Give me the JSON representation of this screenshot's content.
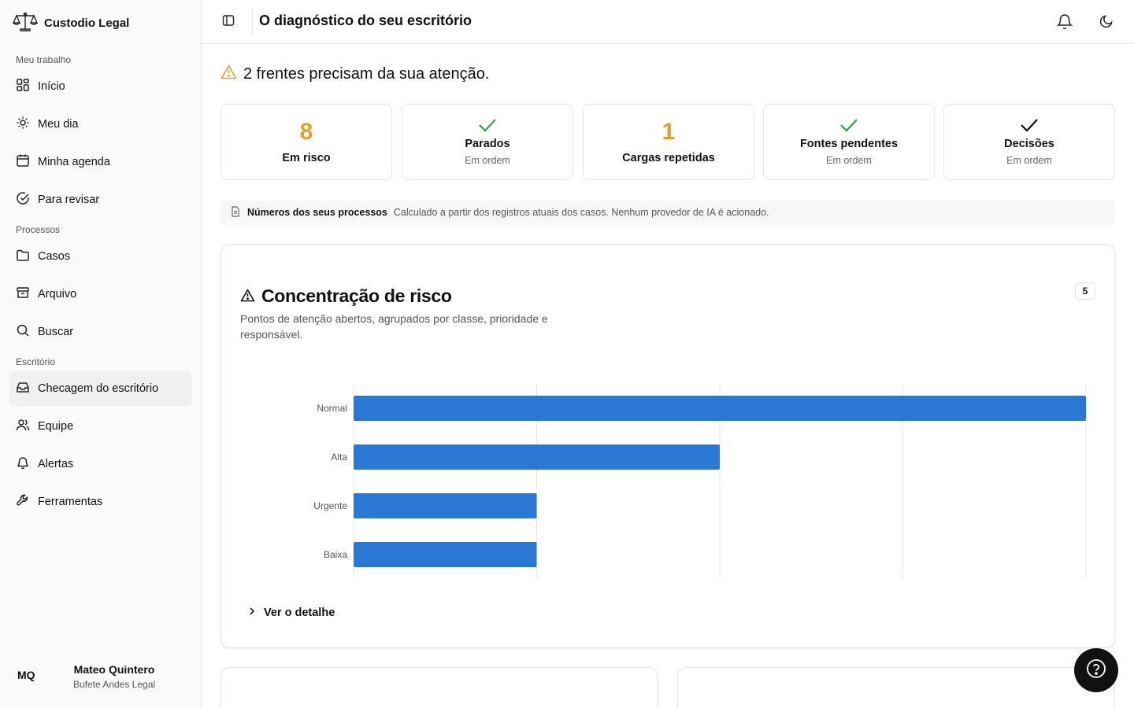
{
  "brand": {
    "name": "Custodio Legal"
  },
  "sidebar": {
    "sections": [
      {
        "label": "Meu trabalho"
      },
      {
        "label": "Processos"
      },
      {
        "label": "Escritório"
      }
    ],
    "items": [
      {
        "label": "Início",
        "icon": "grid-icon"
      },
      {
        "label": "Meu dia",
        "icon": "sun-icon"
      },
      {
        "label": "Minha agenda",
        "icon": "calendar-icon"
      },
      {
        "label": "Para revisar",
        "icon": "check-circle-icon"
      },
      {
        "label": "Casos",
        "icon": "folder-icon"
      },
      {
        "label": "Arquivo",
        "icon": "archive-icon"
      },
      {
        "label": "Buscar",
        "icon": "search-icon"
      },
      {
        "label": "Checagem do escritório",
        "icon": "inbox-icon",
        "active": true
      },
      {
        "label": "Equipe",
        "icon": "users-icon"
      },
      {
        "label": "Alertas",
        "icon": "bell-icon"
      },
      {
        "label": "Ferramentas",
        "icon": "wrench-icon"
      }
    ],
    "user": {
      "initials": "MQ",
      "name": "Mateo Quintero",
      "org": "Bufete Andes Legal"
    }
  },
  "header": {
    "title": "O diagnóstico do seu escritório"
  },
  "alert": {
    "text": "2 frentes precisam da sua atenção."
  },
  "cards": [
    {
      "value": "8",
      "label": "Em risco"
    },
    {
      "label": "Parados",
      "status": "Em ordem",
      "check_color": "#3a9a4a"
    },
    {
      "value": "1",
      "label": "Cargas repetidas"
    },
    {
      "label": "Fontes pendentes",
      "status": "Em ordem",
      "check_color": "#3a9a4a"
    },
    {
      "label": "Decisões",
      "status": "Em ordem",
      "check_color": "#111111"
    }
  ],
  "info": {
    "title": "Números dos seus processos",
    "text": "Calculado a partir dos registros atuais dos casos. Nenhum provedor de IA é acionado."
  },
  "risk_panel": {
    "title": "Concentração de risco",
    "description": "Pontos de atenção abertos, agrupados por classe, prioridade e responsável.",
    "count": "5",
    "detail_label": "Ver o detalhe"
  },
  "chart_data": {
    "type": "bar",
    "orientation": "horizontal",
    "categories": [
      "Normal",
      "Alta",
      "Urgente",
      "Baixa"
    ],
    "values": [
      4,
      2,
      1,
      1
    ],
    "xlim": [
      0,
      4
    ],
    "grid": true,
    "bar_color": "#2b78d4"
  },
  "colors": {
    "accent_number": "#e0a030",
    "warning_icon": "#e0a030",
    "bar": "#2b78d4"
  }
}
